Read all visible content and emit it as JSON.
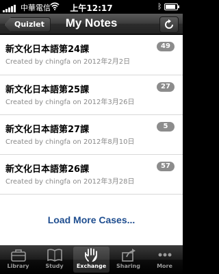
{
  "status_bar": {
    "carrier": "中華電信",
    "time": "上午12:17",
    "battery_level": 0.85
  },
  "navbar": {
    "back_label": "Quizlet",
    "title": "My Notes",
    "refresh_icon": "refresh-icon"
  },
  "notes": [
    {
      "title": "新文化日本語第24課",
      "subtitle": "Created by chingfa on 2012年2月2日",
      "count": "49"
    },
    {
      "title": "新文化日本語第25課",
      "subtitle": "Created by chingfa on 2012年3月26日",
      "count": "27"
    },
    {
      "title": "新文化日本語第27課",
      "subtitle": "Created by chingfa on 2012年8月10日",
      "count": "5"
    },
    {
      "title": "新文化日本語第26課",
      "subtitle": "Created by chingfa on 2012年3月28日",
      "count": "57"
    }
  ],
  "load_more": "Load More Cases...",
  "tabs": [
    {
      "label": "Library",
      "icon": "briefcase-icon",
      "active": false
    },
    {
      "label": "Study",
      "icon": "book-icon",
      "active": false
    },
    {
      "label": "Exchange",
      "icon": "hand-icon",
      "active": true
    },
    {
      "label": "Sharing",
      "icon": "share-arrow-icon",
      "active": false
    },
    {
      "label": "More",
      "icon": "more-dots-icon",
      "active": false
    }
  ],
  "colors": {
    "badge": "#8c8c8c",
    "link": "#1e4d8f",
    "tab_active": "#ffffff",
    "tab_inactive": "#9a9a9a"
  }
}
